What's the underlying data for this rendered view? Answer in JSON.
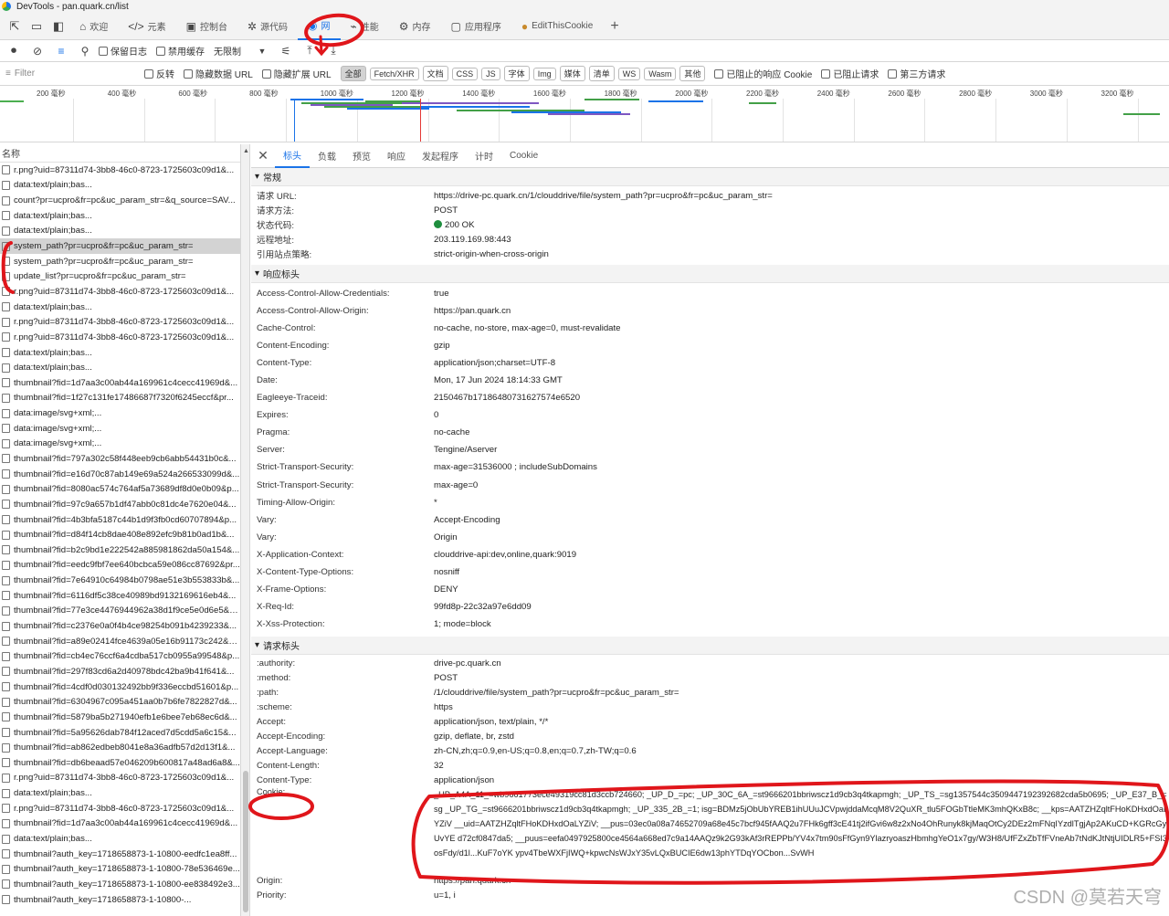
{
  "window_title": "DevTools - pan.quark.cn/list",
  "tabs": [
    {
      "label": "欢迎",
      "icon": "home-icon"
    },
    {
      "label": "元素",
      "icon": "code-icon"
    },
    {
      "label": "控制台",
      "icon": "console-icon"
    },
    {
      "label": "源代码",
      "icon": "bug-icon"
    },
    {
      "label": "网",
      "icon": "wifi-icon",
      "active": true
    },
    {
      "label": "性能",
      "icon": "performance-icon"
    },
    {
      "label": "内存",
      "icon": "memory-icon"
    },
    {
      "label": "应用程序",
      "icon": "application-icon"
    },
    {
      "label": "EditThisCookie",
      "icon": "cookie-icon"
    }
  ],
  "toolbar": {
    "preserve_log": "保留日志",
    "disable_cache": "禁用缓存",
    "throttle": "无限制"
  },
  "filterbar": {
    "placeholder": "Filter",
    "invert": "反转",
    "hide_data_urls": "隐藏数据 URL",
    "hide_ext_urls": "隐藏扩展 URL",
    "types": [
      "全部",
      "Fetch/XHR",
      "文档",
      "CSS",
      "JS",
      "字体",
      "Img",
      "媒体",
      "清单",
      "WS",
      "Wasm",
      "其他"
    ],
    "blocked_cookies": "已阻止的响应 Cookie",
    "blocked_requests": "已阻止请求",
    "third_party": "第三方请求"
  },
  "timeline": {
    "ticks": [
      "200 毫秒",
      "400 毫秒",
      "600 毫秒",
      "800 毫秒",
      "1000 毫秒",
      "1200 毫秒",
      "1400 毫秒",
      "1600 毫秒",
      "1800 毫秒",
      "2000 毫秒",
      "2200 毫秒",
      "2400 毫秒",
      "2600 毫秒",
      "2800 毫秒",
      "3000 毫秒",
      "3200 毫秒",
      "34"
    ]
  },
  "request_list": {
    "header": "名称",
    "rows": [
      "r.png?uid=87311d74-3bb8-46c0-8723-1725603c09d1&...",
      "data:text/plain;bas...",
      "count?pr=ucpro&fr=pc&uc_param_str=&q_source=SAV...",
      "data:text/plain;bas...",
      "data:text/plain;bas...",
      "system_path?pr=ucpro&fr=pc&uc_param_str=",
      "system_path?pr=ucpro&fr=pc&uc_param_str=",
      "update_list?pr=ucpro&fr=pc&uc_param_str=",
      "r.png?uid=87311d74-3bb8-46c0-8723-1725603c09d1&...",
      "data:text/plain;bas...",
      "r.png?uid=87311d74-3bb8-46c0-8723-1725603c09d1&...",
      "r.png?uid=87311d74-3bb8-46c0-8723-1725603c09d1&...",
      "data:text/plain;bas...",
      "data:text/plain;bas...",
      "thumbnail?fid=1d7aa3c00ab44a169961c4cecc41969d&...",
      "thumbnail?fid=1f27c131fe17486687f7320f6245eccf&pr...",
      "data:image/svg+xml;...",
      "data:image/svg+xml;...",
      "data:image/svg+xml;...",
      "thumbnail?fid=797a302c58f448eeb9cb6abb54431b0c&...",
      "thumbnail?fid=e16d70c87ab149e69a524a266533099d&...",
      "thumbnail?fid=8080ac574c764af5a73689df8d0e0b09&p...",
      "thumbnail?fid=97c9a657b1df47abb0c81dc4e7620e04&...",
      "thumbnail?fid=4b3bfa5187c44b1d9f3fb0cd60707894&p...",
      "thumbnail?fid=d84f14cb8dae408e892efc9b81b0ad1b&...",
      "thumbnail?fid=b2c9bd1e222542a885981862da50a154&...",
      "thumbnail?fid=eedc9fbf7ee640bcbca59e086cc87692&pr...",
      "thumbnail?fid=7e64910c64984b0798ae51e3b553833b&...",
      "thumbnail?fid=6116df5c38ce40989bd9132169616eb4&...",
      "thumbnail?fid=77e3ce4476944962a38d1f9ce5e0d6e5&p...",
      "thumbnail?fid=c2376e0a0f4b4ce98254b091b4239233&...",
      "thumbnail?fid=a89e02414fce4639a05e16b91173c242&p...",
      "thumbnail?fid=cb4ec76ccf6a4cdba517cb0955a99548&p...",
      "thumbnail?fid=297f83cd6a2d40978bdc42ba9b41f641&...",
      "thumbnail?fid=4cdf0d030132492bb9f336eccbd51601&p...",
      "thumbnail?fid=6304967c095a451aa0b7b6fe7822827d&...",
      "thumbnail?fid=5879ba5b271940efb1e6bee7eb68ec6d&...",
      "thumbnail?fid=5a95626dab784f12aced7d5cdd5a6c15&...",
      "thumbnail?fid=ab862edbeb8041e8a36adfb57d2d13f1&...",
      "thumbnail?fid=db6beaad57e046209b600817a48ad6a8&...",
      "r.png?uid=87311d74-3bb8-46c0-8723-1725603c09d1&...",
      "data:text/plain;bas...",
      "r.png?uid=87311d74-3bb8-46c0-8723-1725603c09d1&...",
      "thumbnail?fid=1d7aa3c00ab44a169961c4cecc41969d&...",
      "data:text/plain;bas...",
      "thumbnail?auth_key=1718658873-1-10800-eedfc1ea8ff...",
      "thumbnail?auth_key=1718658873-1-10800-78e536469e...",
      "thumbnail?auth_key=1718658873-1-10800-ee838492e3...",
      "thumbnail?auth_key=1718658873-1-10800-..."
    ]
  },
  "details": {
    "tabs": [
      "标头",
      "负载",
      "预览",
      "响应",
      "发起程序",
      "计时",
      "Cookie"
    ],
    "general_title": "常规",
    "general": [
      {
        "k": "请求 URL:",
        "v": "https://drive-pc.quark.cn/1/clouddrive/file/system_path?pr=ucpro&fr=pc&uc_param_str="
      },
      {
        "k": "请求方法:",
        "v": "POST"
      },
      {
        "k": "状态代码:",
        "v": "200 OK"
      },
      {
        "k": "远程地址:",
        "v": "203.119.169.98:443"
      },
      {
        "k": "引用站点策略:",
        "v": "strict-origin-when-cross-origin"
      }
    ],
    "response_title": "响应标头",
    "response_headers": [
      {
        "k": "Access-Control-Allow-Credentials:",
        "v": "true"
      },
      {
        "k": "Access-Control-Allow-Origin:",
        "v": "https://pan.quark.cn"
      },
      {
        "k": "Cache-Control:",
        "v": "no-cache, no-store, max-age=0, must-revalidate"
      },
      {
        "k": "Content-Encoding:",
        "v": "gzip"
      },
      {
        "k": "Content-Type:",
        "v": "application/json;charset=UTF-8"
      },
      {
        "k": "Date:",
        "v": "Mon, 17 Jun 2024 18:14:33 GMT"
      },
      {
        "k": "Eagleeye-Traceid:",
        "v": "2150467b17186480731627574e6520"
      },
      {
        "k": "Expires:",
        "v": "0"
      },
      {
        "k": "Pragma:",
        "v": "no-cache"
      },
      {
        "k": "Server:",
        "v": "Tengine/Aserver"
      },
      {
        "k": "Strict-Transport-Security:",
        "v": "max-age=31536000 ; includeSubDomains"
      },
      {
        "k": "Strict-Transport-Security:",
        "v": "max-age=0"
      },
      {
        "k": "Timing-Allow-Origin:",
        "v": "*"
      },
      {
        "k": "Vary:",
        "v": "Accept-Encoding"
      },
      {
        "k": "Vary:",
        "v": "Origin"
      },
      {
        "k": "X-Application-Context:",
        "v": "clouddrive-api:dev,online,quark:9019"
      },
      {
        "k": "X-Content-Type-Options:",
        "v": "nosniff"
      },
      {
        "k": "X-Frame-Options:",
        "v": "DENY"
      },
      {
        "k": "X-Req-Id:",
        "v": "99fd8p-22c32a97e6dd09"
      },
      {
        "k": "X-Xss-Protection:",
        "v": "1; mode=block"
      }
    ],
    "request_title": "请求标头",
    "request_headers": [
      {
        "k": ":authority:",
        "v": "drive-pc.quark.cn"
      },
      {
        "k": ":method:",
        "v": "POST"
      },
      {
        "k": ":path:",
        "v": "/1/clouddrive/file/system_path?pr=ucpro&fr=pc&uc_param_str="
      },
      {
        "k": ":scheme:",
        "v": "https"
      },
      {
        "k": "Accept:",
        "v": "application/json, text/plain, */*"
      },
      {
        "k": "Accept-Encoding:",
        "v": "gzip, deflate, br, zstd"
      },
      {
        "k": "Accept-Language:",
        "v": "zh-CN,zh;q=0.9,en-US;q=0.8,en;q=0.7,zh-TW;q=0.6"
      },
      {
        "k": "Content-Length:",
        "v": "32"
      },
      {
        "k": "Content-Type:",
        "v": "application/json"
      }
    ],
    "cookie_key": "Cookie:",
    "cookie_value": "_UP_A4A_11_=wb9661773ece49319cc81d3ccb724660; _UP_D_=pc; _UP_30C_6A_=st9666201bbriwscz1d9cb3q4tkapmgh; _UP_TS_=sg1357544c3509447192392682cda5b0695; _UP_E37_B_=sg _UP_TG_=st9666201bbriwscz1d9cb3q4tkapmgh; _UP_335_2B_=1; isg=BDMz5jObUbYREB1ihUUuJCVpwjddaMcqM8V2QuXR_tlu5FOGbTtleMK3mhQKxB8c; __kps=AATZHZqltFHoKDHxdOaLYZiV __uid=AATZHZqltFHoKDHxdOaLYZiV; __pus=03ec0a08a74652709a68e45c7bcf945fAAQ2u7FHk6gff3cE41tj2ifGvi6w8z2xNo4OhRunyk8kjMaqOtCy2DEz2mFNqIYzdlTgjAp2AKuCD+KGRcGyUvYE d72cf0847da5; __puus=eefa0497925800ce4564a668ed7c9a14AAQz9k2G93kAf3rREPPb/YV4x7tm90sFfGyn9YlazryoaszHbmhgYeO1x7gy/W3H8/UfFZxZbTfFVneAb7tNdKJtNtjUIDLR5+FSI3osFdy/d1l...KuF7oYK ypv4TbeWXFjIWQ+kpwcNsWJxY35vLQxBUCIE6dw13phYTDqYOCbon...SvWH",
    "tail_headers": [
      {
        "k": "Origin:",
        "v": "https://pan.quark.cn"
      },
      {
        "k": "Priority:",
        "v": "u=1, i"
      }
    ]
  },
  "watermark": "CSDN @莫若天穹"
}
